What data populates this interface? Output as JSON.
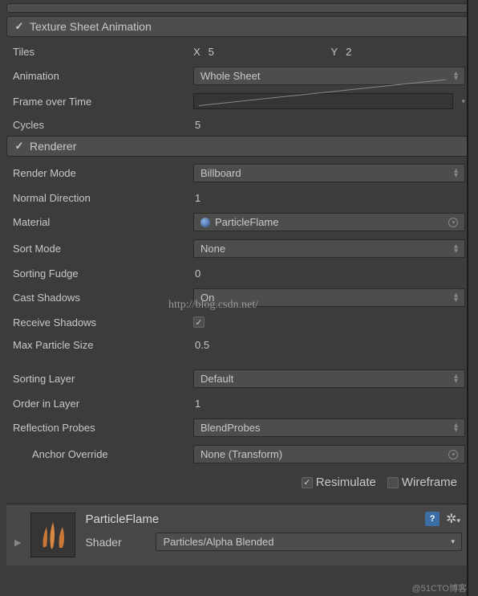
{
  "sections": {
    "texture_sheet": {
      "title": "Texture Sheet Animation",
      "enabled": true,
      "tiles_label": "Tiles",
      "tiles_x_label": "X",
      "tiles_x": "5",
      "tiles_y_label": "Y",
      "tiles_y": "2",
      "animation_label": "Animation",
      "animation_value": "Whole Sheet",
      "frame_label": "Frame over Time",
      "cycles_label": "Cycles",
      "cycles_value": "5"
    },
    "renderer": {
      "title": "Renderer",
      "enabled": true,
      "render_mode_label": "Render Mode",
      "render_mode_value": "Billboard",
      "normal_dir_label": "Normal Direction",
      "normal_dir_value": "1",
      "material_label": "Material",
      "material_value": "ParticleFlame",
      "sort_mode_label": "Sort Mode",
      "sort_mode_value": "None",
      "sorting_fudge_label": "Sorting Fudge",
      "sorting_fudge_value": "0",
      "cast_shadows_label": "Cast Shadows",
      "cast_shadows_value": "On",
      "receive_shadows_label": "Receive Shadows",
      "receive_shadows_checked": true,
      "max_particle_label": "Max Particle Size",
      "max_particle_value": "0.5",
      "sorting_layer_label": "Sorting Layer",
      "sorting_layer_value": "Default",
      "order_layer_label": "Order in Layer",
      "order_layer_value": "1",
      "reflection_label": "Reflection Probes",
      "reflection_value": "BlendProbes",
      "anchor_label": "Anchor Override",
      "anchor_value": "None (Transform)"
    }
  },
  "footer": {
    "resimulate_label": "Resimulate",
    "resimulate_checked": true,
    "wireframe_label": "Wireframe",
    "wireframe_checked": false
  },
  "material_inspector": {
    "name": "ParticleFlame",
    "shader_label": "Shader",
    "shader_value": "Particles/Alpha Blended"
  },
  "watermark": "http://blog.csdn.net/",
  "corner_watermark": "@51CTO博客"
}
